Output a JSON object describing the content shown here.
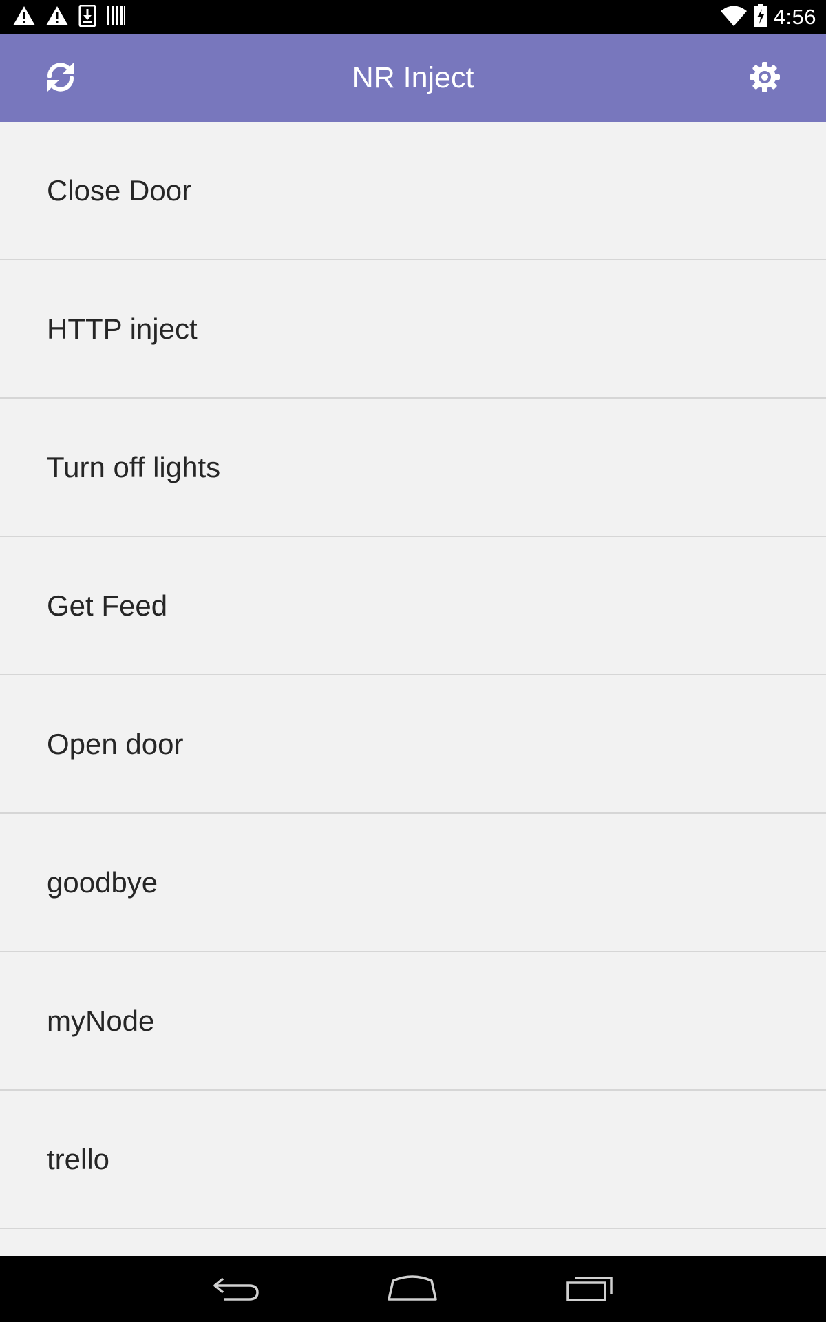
{
  "status_bar": {
    "time": "4:56",
    "left_icons": [
      "warning-icon",
      "warning-icon",
      "download-icon",
      "barcode-icon"
    ],
    "right_icons": [
      "wifi-icon",
      "battery-charging-icon"
    ]
  },
  "app_bar": {
    "title": "NR Inject",
    "background_color": "#7877bd",
    "left_action": "refresh-icon",
    "right_action": "gear-icon"
  },
  "list": {
    "items": [
      {
        "label": "Close Door"
      },
      {
        "label": "HTTP inject"
      },
      {
        "label": "Turn off lights"
      },
      {
        "label": "Get Feed"
      },
      {
        "label": "Open door"
      },
      {
        "label": "goodbye"
      },
      {
        "label": "myNode"
      },
      {
        "label": "trello"
      }
    ]
  },
  "nav_bar": {
    "buttons": [
      "back-icon",
      "home-icon",
      "recents-icon"
    ]
  }
}
